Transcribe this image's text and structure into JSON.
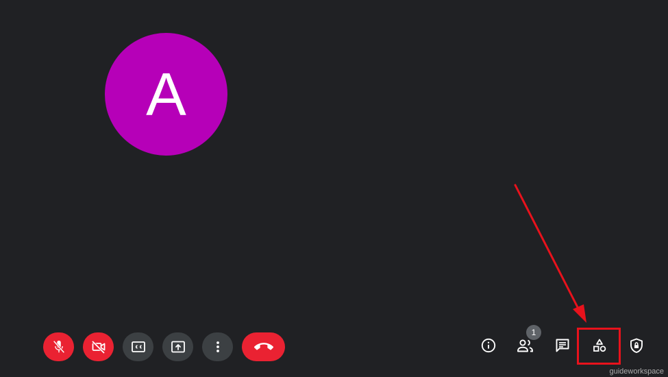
{
  "participant": {
    "initial": "A",
    "avatar_color": "#b600b8"
  },
  "controls": {
    "mic": {
      "icon": "mic-off-icon",
      "state": "muted"
    },
    "camera": {
      "icon": "camera-off-icon",
      "state": "off"
    },
    "captions": {
      "icon": "captions-icon",
      "label": "CC"
    },
    "present": {
      "icon": "present-screen-icon"
    },
    "more": {
      "icon": "more-vert-icon"
    },
    "leave": {
      "icon": "end-call-icon"
    }
  },
  "side_controls": {
    "info": {
      "icon": "info-icon"
    },
    "people": {
      "icon": "people-icon",
      "count": "1"
    },
    "chat": {
      "icon": "chat-icon"
    },
    "activities": {
      "icon": "activities-icon",
      "highlighted": true
    },
    "host_controls": {
      "icon": "shield-lock-icon"
    }
  },
  "annotation": {
    "color": "#e8121c"
  },
  "watermark": "guideworkspace",
  "colors": {
    "background": "#202124",
    "danger": "#ea2232",
    "button_grey": "#3c4043",
    "badge_grey": "#5f6368"
  }
}
